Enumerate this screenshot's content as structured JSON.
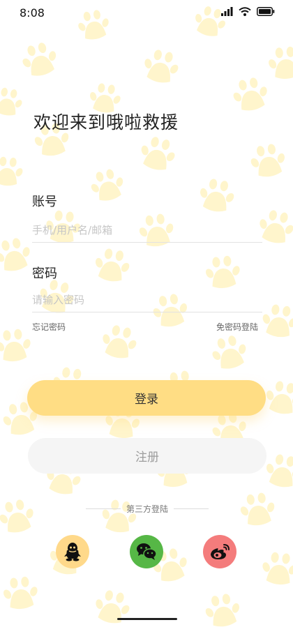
{
  "status_bar": {
    "time": "8:08",
    "icons": [
      "cellular-signal-icon",
      "wifi-icon",
      "battery-icon"
    ]
  },
  "login": {
    "title": "欢迎来到哦啦救援",
    "account_label": "账号",
    "account_placeholder": "手机/用户名/邮箱",
    "password_label": "密码",
    "password_placeholder": "请输入密码",
    "forgot_password": "忘记密码",
    "password_free_login": "免密码登陆",
    "login_button": "登录",
    "register_button": "注册"
  },
  "third_party": {
    "label": "第三方登陆",
    "providers": [
      {
        "name": "qq",
        "icon": "qq-penguin-icon",
        "color": "#ffd98a"
      },
      {
        "name": "wechat",
        "icon": "wechat-icon",
        "color": "#56b746"
      },
      {
        "name": "weibo",
        "icon": "weibo-icon",
        "color": "#f47c7c"
      }
    ]
  },
  "colors": {
    "accent": "#ffdd84",
    "paw_pattern": "#fff5cc",
    "secondary_button": "#f5f5f5"
  }
}
